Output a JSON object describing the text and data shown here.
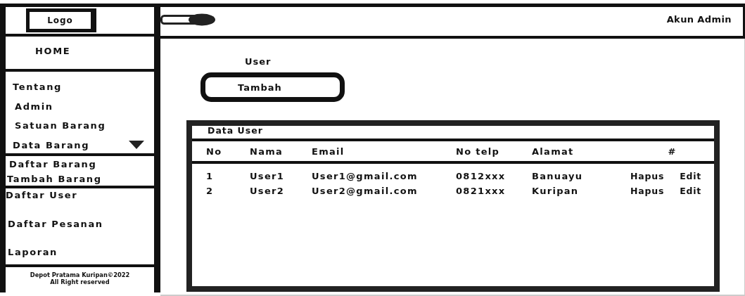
{
  "logo": "Logo",
  "sidebar": {
    "sections": [
      {
        "items": [
          {
            "label": "HOME"
          }
        ]
      },
      {
        "items": [
          {
            "label": "Tentang"
          },
          {
            "label": "Admin"
          },
          {
            "label": "Satuan Barang"
          },
          {
            "label": "Data Barang",
            "expanded": true,
            "children": [
              {
                "label": "Daftar Barang"
              },
              {
                "label": "Tambah Barang"
              }
            ]
          }
        ]
      },
      {
        "items": [
          {
            "label": "Daftar User"
          },
          {
            "label": "Daftar Pesanan"
          },
          {
            "label": "Laporan"
          }
        ]
      }
    ],
    "footer": [
      "Depot Pratama Kuripan©2022",
      "All Right reserved"
    ]
  },
  "topbar": {
    "account": "Akun Admin"
  },
  "page": {
    "title": "User",
    "add_button": "Tambah",
    "table": {
      "title": "Data User",
      "columns": [
        "No",
        "Nama",
        "Email",
        "No telp",
        "Alamat",
        "#"
      ],
      "rows": [
        {
          "cells": [
            "1",
            "User1",
            "User1@gmail.com",
            "0812xxx",
            "Banuayu"
          ],
          "actions": [
            "Hapus",
            "Edit"
          ]
        },
        {
          "cells": [
            "2",
            "User2",
            "User2@gmail.com",
            "0821xxx",
            "Kuripan"
          ],
          "actions": [
            "Hapus",
            "Edit"
          ]
        }
      ]
    }
  }
}
